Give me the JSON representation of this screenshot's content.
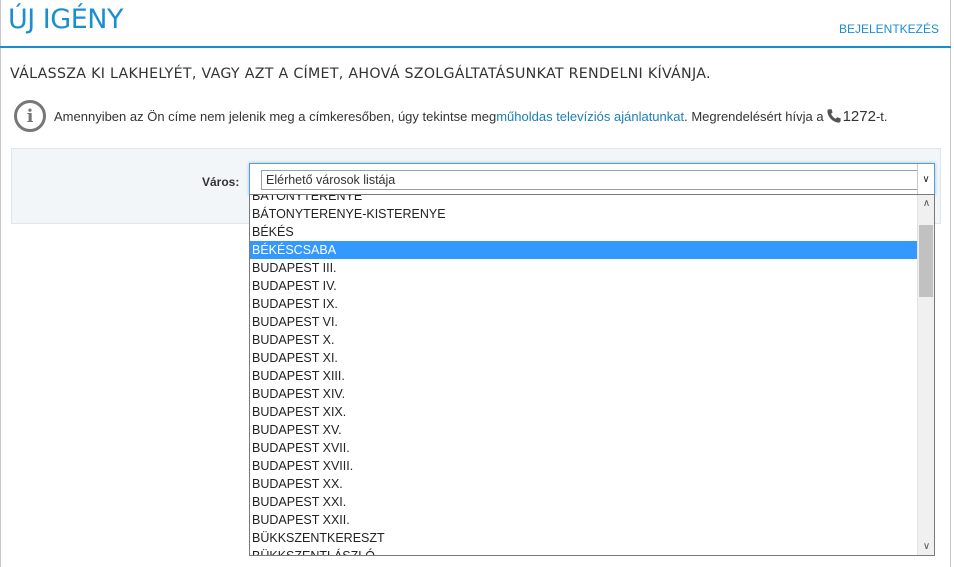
{
  "header": {
    "title": "ÚJ IGÉNY",
    "login_label": "BEJELENTKEZÉS"
  },
  "subtitle": "VÁLASSZA KI LAKHELYÉT, VAGY AZT A CÍMET, AHOVÁ SZOLGÁLTATÁSUNKAT RENDELNI KÍVÁNJA.",
  "info": {
    "icon": "info-icon",
    "text_before": "Amennyiben az Ön címe nem jelenik meg a címkeresőben, úgy tekintse meg ",
    "link_text": "műholdas televíziós ajánlatunkat",
    "text_after": ". Megrendelésért hívja a ",
    "phone_icon": "phone-icon",
    "phone_number": "1272",
    "phone_suffix": "-t."
  },
  "form": {
    "city_label": "Város:",
    "select_value": "Elérhető városok listája",
    "options": [
      "BÁTONYTERENYE",
      "BÁTONYTERENYE-KISTERENYE",
      "BÉKÉS",
      "BÉKÉSCSABA",
      "BUDAPEST III.",
      "BUDAPEST IV.",
      "BUDAPEST IX.",
      "BUDAPEST VI.",
      "BUDAPEST X.",
      "BUDAPEST XI.",
      "BUDAPEST XIII.",
      "BUDAPEST XIV.",
      "BUDAPEST XIX.",
      "BUDAPEST XV.",
      "BUDAPEST XVII.",
      "BUDAPEST XVIII.",
      "BUDAPEST XX.",
      "BUDAPEST XXI.",
      "BUDAPEST XXII.",
      "BÜKKSZENTKERESZT",
      "BÜKKSZENTLÁSZLÓ"
    ],
    "selected_option": "BÉKÉSCSABA"
  },
  "colors": {
    "brand": "#1a8fd0",
    "selection": "#3399ff"
  }
}
